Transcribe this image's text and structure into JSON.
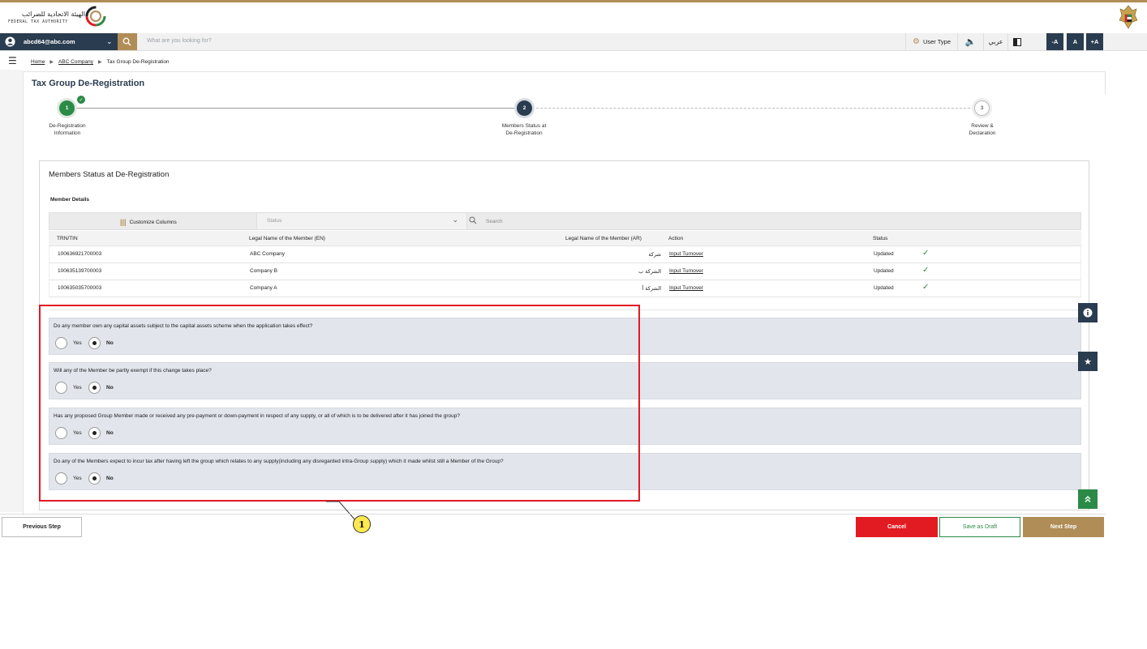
{
  "logo": {
    "arabic": "الهيئة الاتحادية للضرائب",
    "english": "FEDERAL TAX AUTHORITY"
  },
  "nav": {
    "user_email": "abcd64@abc.com",
    "search_placeholder": "What are you looking for?",
    "user_type": "User Type",
    "language": "عربي",
    "font_decrease": "-A",
    "font_normal": "A",
    "font_increase": "+A"
  },
  "breadcrumb": {
    "home": "Home",
    "company": "ABC Company",
    "current": "Tax Group De-Registration"
  },
  "page": {
    "title": "Tax Group De-Registration"
  },
  "stepper": {
    "steps": [
      {
        "number": "1",
        "label_line1": "De-Registration",
        "label_line2": "Information",
        "state": "completed"
      },
      {
        "number": "2",
        "label_line1": "Members Status at",
        "label_line2": "De-Registration",
        "state": "active"
      },
      {
        "number": "3",
        "label_line1": "Review &",
        "label_line2": "Declaration",
        "state": "pending"
      }
    ]
  },
  "members": {
    "section_title": "Members Status at De-Registration",
    "subheading": "Member Details",
    "customize_label": "Customize Columns",
    "status_placeholder": "Status",
    "search_placeholder": "Search",
    "columns": {
      "trn": "TRN/TIN",
      "name_en": "Legal Name of the Member (EN)",
      "name_ar": "Legal Name of the Member (AR)",
      "action": "Action",
      "status": "Status"
    },
    "rows": [
      {
        "trn": "100636921700003",
        "name_en": "ABC Company",
        "name_ar": "شركة",
        "action": "Input Turnover",
        "status": "Updated"
      },
      {
        "trn": "100635139700003",
        "name_en": "Company B",
        "name_ar": "الشركة ب",
        "action": "Input Turnover",
        "status": "Updated"
      },
      {
        "trn": "100635035700003",
        "name_en": "Company A",
        "name_ar": "الشركة أ",
        "action": "Input Turnover",
        "status": "Updated"
      }
    ]
  },
  "questions": {
    "yes_label": "Yes",
    "no_label": "No",
    "items": [
      {
        "text": "Do any member own any capital assets subject to the capital assets scheme when the application takes effect?",
        "selected": "No"
      },
      {
        "text": "Will any of the Member be partly exempt if this change takes place?",
        "selected": "No"
      },
      {
        "text": "Has any proposed Group Member made or received any pre-payment or down-payment in respect of any supply, or all of which is to be delivered after it has joined the group?",
        "selected": "No"
      },
      {
        "text": "Do any of the Members expect to incur tax after having left the group which relates to any supply(including any disregarded intra-Group supply) which it made whilst still a Member of the Group?",
        "selected": "No"
      }
    ]
  },
  "callout": {
    "number": "1"
  },
  "footer": {
    "previous": "Previous Step",
    "cancel": "Cancel",
    "save_draft": "Save as Draft",
    "next": "Next Step"
  },
  "colors": {
    "navy": "#2a3c4f",
    "gold": "#b08d57",
    "green": "#2c8a47",
    "red": "#e21b23",
    "question_bg": "#e2e5ec"
  },
  "icons": {
    "user": "user-circle-icon",
    "search": "search-icon",
    "settings": "gear-icon",
    "audio": "speaker-icon",
    "contrast": "contrast-icon",
    "menu": "hamburger-icon",
    "info": "info-icon",
    "favorite": "star-icon",
    "scroll_top": "double-chevron-up-icon",
    "status_ok": "check-icon"
  }
}
